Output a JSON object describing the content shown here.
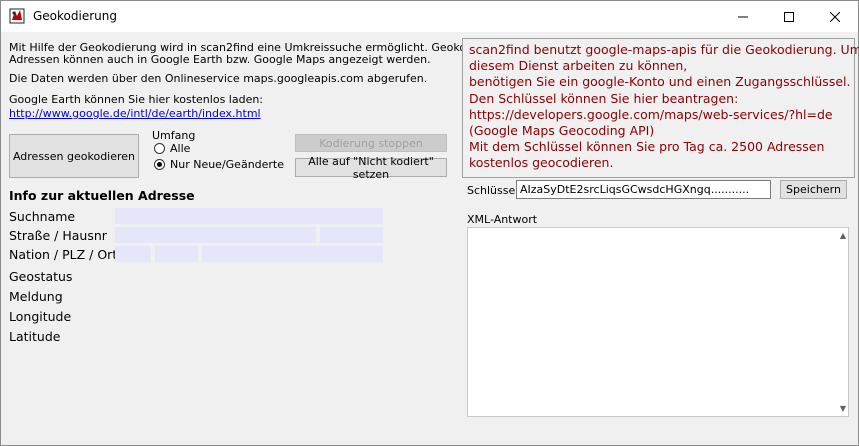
{
  "window": {
    "title": "Geokodierung"
  },
  "description": {
    "line1": "Mit Hilfe der Geokodierung wird in scan2find eine Umkreissuche  ermöglicht. Geokodierte",
    "line2": "Adressen können auch in Google Earth bzw. Google Maps angezeigt werden.",
    "line3": "Die Daten werden über den Onlineservice maps.googleapis.com abgerufen.",
    "line4": "Google Earth können Sie hier kostenlos laden:",
    "link": "http://www.google.de/intl/de/earth/index.html"
  },
  "buttons": {
    "geocode": "Adressen geokodieren",
    "stop": "Kodierung stoppen",
    "reset": "Alle auf \"Nicht kodiert\" setzen",
    "save": "Speichern"
  },
  "scope": {
    "label": "Umfang",
    "options": [
      "Alle",
      "Nur Neue/Geänderte"
    ],
    "selected": "Nur Neue/Geänderte"
  },
  "info": {
    "heading": "Info zur aktuellen Adresse",
    "labels": {
      "name": "Suchname",
      "street": "Straße / Hausnr",
      "nation": "Nation / PLZ / Ort",
      "geostatus": "Geostatus",
      "message": "Meldung",
      "longitude": "Longitude",
      "latitude": "Latitude"
    }
  },
  "notice": {
    "lines": [
      "scan2find benutzt google-maps-apis für die Geokodierung. Um mit",
      "diesem Dienst arbeiten zu können,",
      "benötigen Sie ein google-Konto und einen Zugangsschlüssel.",
      "Den Schlüssel können Sie hier beantragen:",
      "https://developers.google.com/maps/web-services/?hl=de",
      "(Google Maps Geocoding API)",
      "Mit dem Schlüssel können Sie pro Tag ca. 2500 Adressen",
      "kostenlos geocodieren."
    ],
    "color": "#8b0000"
  },
  "key": {
    "label": "Schlüssel:",
    "value": "AIzaSyDtE2srcLiqsGCwsdcHGXngq..........."
  },
  "xml": {
    "label": "XML-Antwort"
  }
}
